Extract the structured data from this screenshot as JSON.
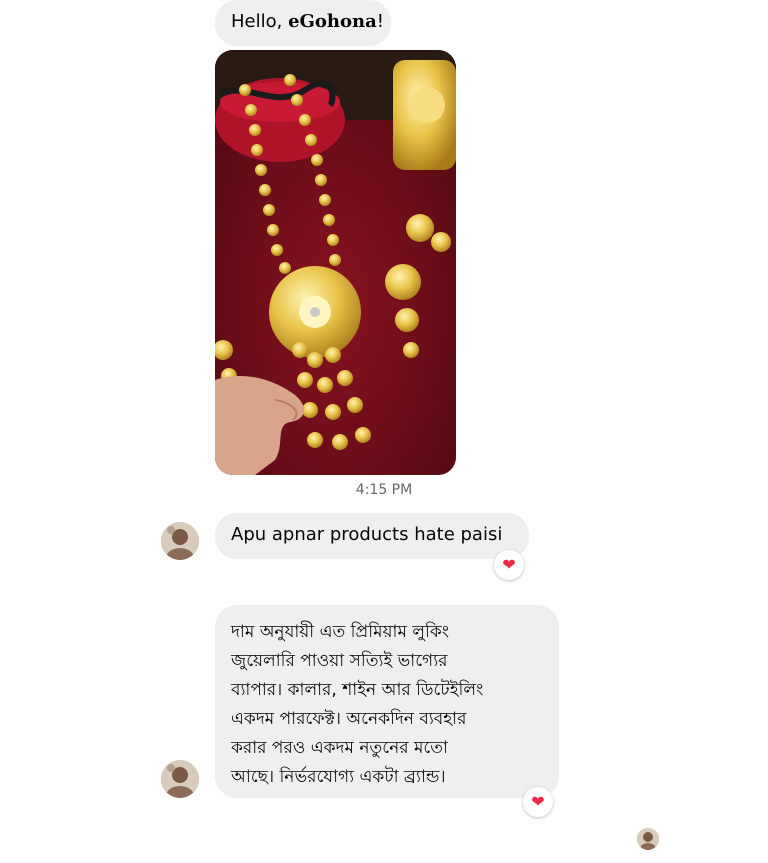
{
  "messages": [
    {
      "kind": "text",
      "prefix": "Hello, ",
      "brand": "eGohona",
      "suffix": "!"
    },
    {
      "kind": "image",
      "description_icon": "gold-jewelry-photo-icon"
    },
    {
      "kind": "timestamp",
      "text": "4:15 PM"
    },
    {
      "kind": "text",
      "text": "Apu apnar products hate paisi",
      "reaction": "❤"
    },
    {
      "kind": "text",
      "lines": [
        "দাম অনুযায়ী এত প্রিমিয়াম লুকিং",
        "জুয়েলারি পাওয়া সত্যিই ভাগ্যের",
        "ব্যাপার। কালার, শাইন আর ডিটেইলিং",
        "একদম পারফেক্ট। অনেকদিন ব্যবহার",
        "করার পরও একদম নতুনের মতো",
        "আছে। নির্ভরযোগ্য একটা ব্র্যান্ড।"
      ],
      "reaction": "❤"
    }
  ],
  "colors": {
    "bubble": "#efeff2",
    "timestamp": "#65676b",
    "heart": "#f02849",
    "velvet": "#6d0d17",
    "gold": "#e8c44a"
  },
  "icons": {
    "avatar": "avatar-icon",
    "seen_avatar": "seen-avatar-icon",
    "heart": "heart-reaction-icon"
  }
}
